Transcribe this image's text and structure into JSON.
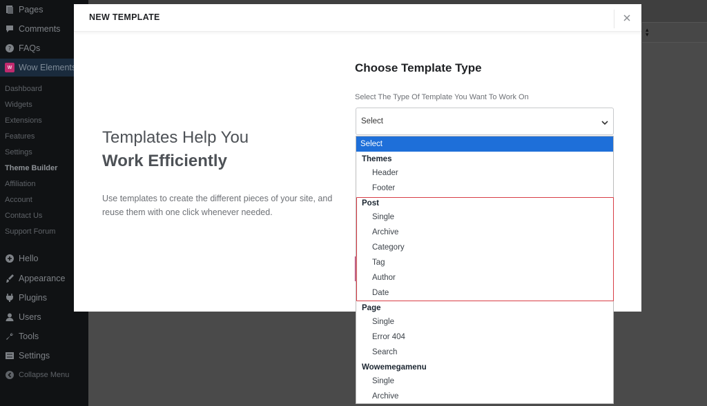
{
  "sidebar": {
    "menu_top": [
      {
        "label": "Pages",
        "icon": "pages-icon"
      },
      {
        "label": "Comments",
        "icon": "comments-icon"
      },
      {
        "label": "FAQs",
        "icon": "faq-icon"
      },
      {
        "label": "Wow Elements",
        "icon": "wow-elements-icon",
        "badge": "W"
      }
    ],
    "submenu": [
      "Dashboard",
      "Widgets",
      "Extensions",
      "Features",
      "Settings",
      "Theme Builder",
      "Affiliation",
      "Account",
      "Contact Us",
      "Support Forum"
    ],
    "active_submenu": "Theme Builder",
    "menu_bottom": [
      {
        "label": "Hello",
        "icon": "plus-circle-icon"
      },
      {
        "label": "Appearance",
        "icon": "brush-icon"
      },
      {
        "label": "Plugins",
        "icon": "plug-icon"
      },
      {
        "label": "Users",
        "icon": "user-icon"
      },
      {
        "label": "Tools",
        "icon": "wrench-icon"
      },
      {
        "label": "Settings",
        "icon": "settings-icon"
      },
      {
        "label": "Collapse Menu",
        "icon": "collapse-icon"
      }
    ]
  },
  "modal": {
    "title": "NEW TEMPLATE",
    "close_icon": "close-icon",
    "promo": {
      "line1": "Templates Help You",
      "line2": "Work Efficiently",
      "description": "Use templates to create the different pieces of your site, and reuse them with one click whenever needed."
    },
    "form": {
      "heading": "Choose Template Type",
      "label": "Select The Type Of Template You Want To Work On",
      "selected_value": "Select"
    }
  },
  "dropdown": {
    "selected_option": "Select",
    "groups": [
      {
        "label": "Themes",
        "options": [
          "Header",
          "Footer"
        ]
      },
      {
        "label": "Post",
        "options": [
          "Single",
          "Archive",
          "Category",
          "Tag",
          "Author",
          "Date"
        ]
      },
      {
        "label": "Page",
        "options": [
          "Single",
          "Error 404",
          "Search"
        ]
      },
      {
        "label": "Wowemegamenu",
        "options": [
          "Single",
          "Archive"
        ]
      }
    ],
    "highlighted_group": "Post"
  },
  "colors": {
    "sidebar_bg": "#101214",
    "selected_option_bg": "#1e6fd9",
    "highlight_border": "#d83c45",
    "brand_badge": "#c02a6e"
  }
}
